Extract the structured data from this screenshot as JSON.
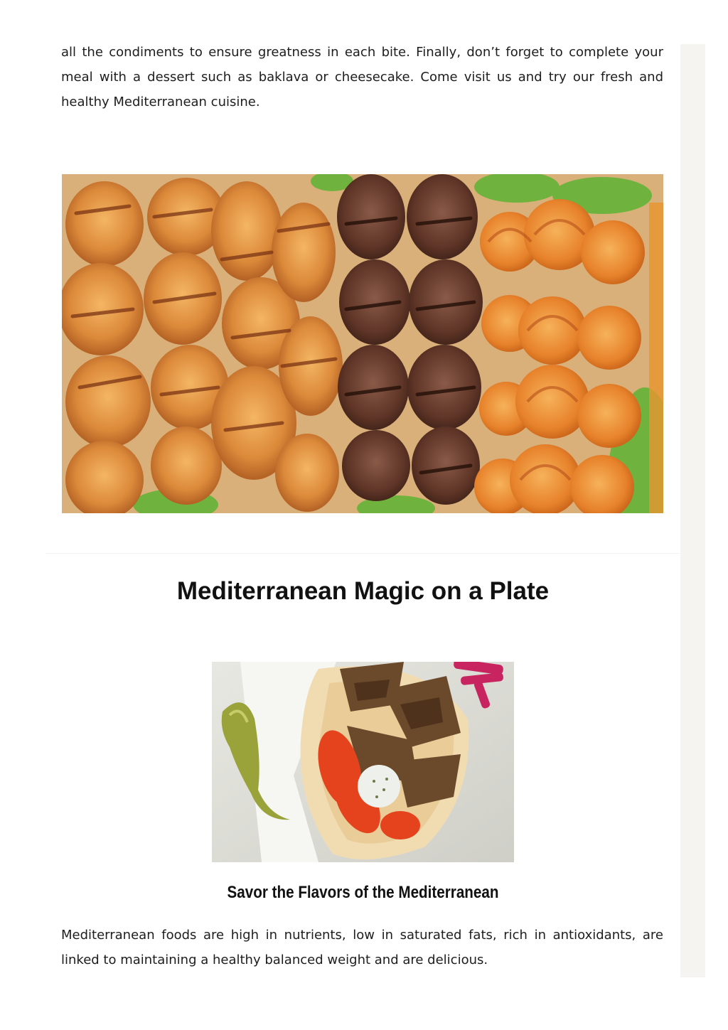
{
  "intro": {
    "text": "all the condiments to ensure greatness in each bite. Finally, don’t forget to complete your meal with a dessert such as baklava or cheesecake. Come visit us and try our fresh and healthy Mediterranean cuisine."
  },
  "images": {
    "kebabs": {
      "alt": "kebab-platter-photo"
    },
    "gyro": {
      "alt": "gyro-wrap-photo"
    }
  },
  "section": {
    "title": "Mediterranean Magic on a Plate",
    "caption": "Savor the Flavors of the Mediterranean",
    "body": "Mediterranean foods are high in nutrients, low in saturated fats, rich in antioxidants, are linked to maintaining a healthy balanced weight and are delicious."
  },
  "colors": {
    "text": "#1d1d1d",
    "heading": "#111111",
    "scrollbar_track": "#f5f4f1"
  }
}
